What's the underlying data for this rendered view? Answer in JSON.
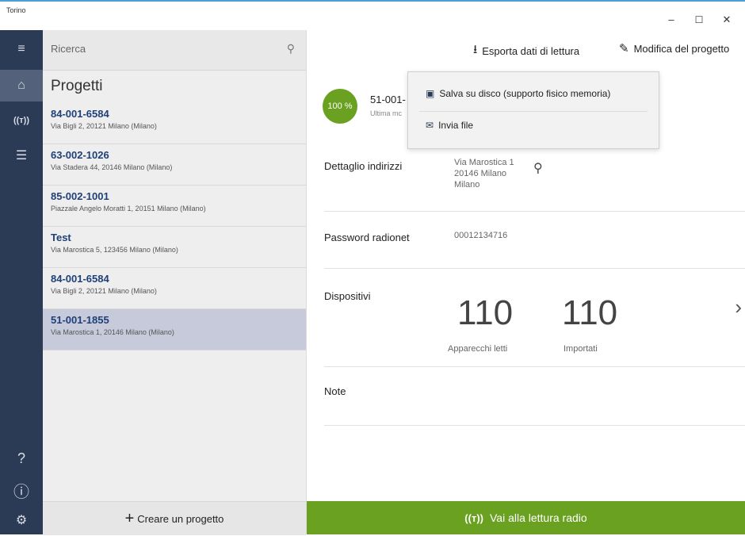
{
  "window": {
    "title": "Torino",
    "minimize": "–",
    "maximize": "☐",
    "close": "✕"
  },
  "rail": {
    "menu_icon": "≡",
    "home_icon": "⌂",
    "radio_icon": "((ᴛ))",
    "list_icon": "☰",
    "help_icon": "?",
    "info_icon": "ⓘ",
    "settings_icon": "⚙"
  },
  "search": {
    "placeholder": "Ricerca",
    "icon": "⚲"
  },
  "projects": {
    "title": "Progetti",
    "items": [
      {
        "code": "84-001-6584",
        "address": "Via Bigli 2, 20121 Milano (Milano)"
      },
      {
        "code": "63-002-1026",
        "address": "Via Stadera 44, 20146 Milano (Milano)"
      },
      {
        "code": "85-002-1001",
        "address": "Piazzale Angelo Moratti 1, 20151 Milano (Milano)"
      },
      {
        "code": "Test",
        "address": "Via Marostica 5, 123456 Milano (Milano)"
      },
      {
        "code": "84-001-6584",
        "address": "Via Bigli 2, 20121 Milano (Milano)"
      },
      {
        "code": "51-001-1855",
        "address": "Via Marostica 1, 20146 Milano (Milano)"
      }
    ],
    "selected_index": 5,
    "create_label": "Creare un progetto",
    "create_icon": "+"
  },
  "toolbar": {
    "export_label": "Esporta dati di lettura",
    "export_icon": "⭳",
    "edit_label": "Modifica del progetto",
    "edit_icon": "✎"
  },
  "dropdown": {
    "save_disk": "Salva su disco (supporto fisico memoria)",
    "send_file": "Invia file",
    "save_icon": "▣",
    "send_icon": "✉"
  },
  "detail": {
    "progress": "100 %",
    "code": "51-001-",
    "subtitle": "Ultima mc",
    "address_label": "Dettaglio indirizzi",
    "address_lines": [
      "Via Marostica 1",
      "20146 Milano",
      "Milano"
    ],
    "map_icon": "⚲",
    "password_label": "Password radionet",
    "password_value": "00012134716",
    "devices_label": "Dispositivi",
    "devices_read": "110",
    "devices_read_label": "Apparecchi letti",
    "devices_imported": "110",
    "devices_imported_label": "Importati",
    "chevron": "›",
    "notes_label": "Note"
  },
  "radio_button": {
    "label": "Vai alla lettura radio",
    "icon": "((ᴛ))"
  },
  "colors": {
    "rail": "#2b3a55",
    "accent_green": "#6aa121",
    "selected_row": "#c6cada",
    "link_blue": "#1f3f78"
  }
}
